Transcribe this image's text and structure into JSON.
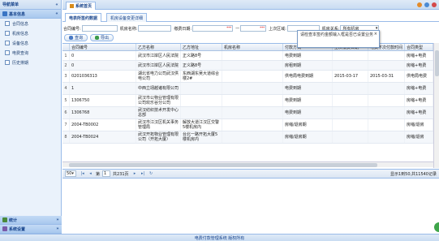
{
  "sidebar": {
    "title": "导航菜单",
    "group": "基本信息",
    "items": [
      {
        "label": "合同信息"
      },
      {
        "label": "机房信息"
      },
      {
        "label": "设备信息"
      },
      {
        "label": "电费查询"
      },
      {
        "label": "历史排期"
      }
    ],
    "bottom_groups": [
      {
        "label": "统计"
      },
      {
        "label": "系统设置"
      }
    ]
  },
  "main": {
    "top_tab": "系统首页",
    "sub_tabs": [
      {
        "label": "电表所签约数据"
      },
      {
        "label": "机房设备变更详细"
      }
    ]
  },
  "filters": {
    "contract_label": "合同编号:",
    "room_label": "机房名称:",
    "pay_date_label": "缴费日期:",
    "date_sep": "—",
    "last_area_label": "上次区域:",
    "room_relation_label": "机房关系:",
    "room_relation_value": "所有机房"
  },
  "buttons": {
    "query": "查询",
    "export": "导出"
  },
  "tooltip": {
    "text": "请检查本签约金额输入框是否已设置业务",
    "close": "×"
  },
  "table": {
    "columns": [
      "合同编号",
      "乙方名称",
      "乙方地址",
      "机房名称",
      "付款方式",
      "上次缴费日期",
      "电费下次付款时间",
      "合同类型"
    ],
    "rows": [
      [
        "1",
        "0",
        "武汉市江岸区人民法院",
        "正义路8号",
        "",
        "电费到期",
        "",
        "",
        "房缩+电费"
      ],
      [
        "2",
        "0",
        "武汉市江岸区人民法院",
        "正义路8号",
        "",
        "房租到期",
        "",
        "",
        "房缩+电费"
      ],
      [
        "3",
        "0201036313",
        "湖北省电力公司武汉供电公司",
        "东西湖东吴大道综合楼2#",
        "",
        "供电局电费到期",
        "2015-03-17",
        "2015-03-31",
        "供电局电费"
      ],
      [
        "4",
        "1",
        "中西立翊越诸有限公司",
        "",
        "",
        "电费到期",
        "",
        "",
        "房缩+电费"
      ],
      [
        "5",
        "1306750",
        "武汉市公物业管理有限公司欢乐谷分公司",
        "",
        "",
        "电费到期",
        "",
        "",
        "房缩+电费"
      ],
      [
        "6",
        "1306768",
        "武汉纺织技术开发中心总部",
        "",
        "",
        "电费到期",
        "",
        "",
        "房缩+电费"
      ],
      [
        "7",
        "2004-TB0002",
        "武汉市江汉区机关事务管理局",
        "解放大道江汉区交警5楼机房内",
        "",
        "房缩/退房期",
        "",
        "",
        "房缩/退房"
      ],
      [
        "8",
        "2004-TB0024",
        "武汉开拓物业管理有限公司（开拓大厦）",
        "台北一路开拓大厦5楼机房内",
        "",
        "房缩/退房期",
        "",
        "",
        "房缩/退房"
      ]
    ]
  },
  "pager": {
    "page_size": "50",
    "page_prefix": "第",
    "page_value": "1",
    "page_suffix": "共231页",
    "info": "显示1到50,共11540记录"
  },
  "footer": {
    "text": "电费付款管理系统 版权所有"
  }
}
